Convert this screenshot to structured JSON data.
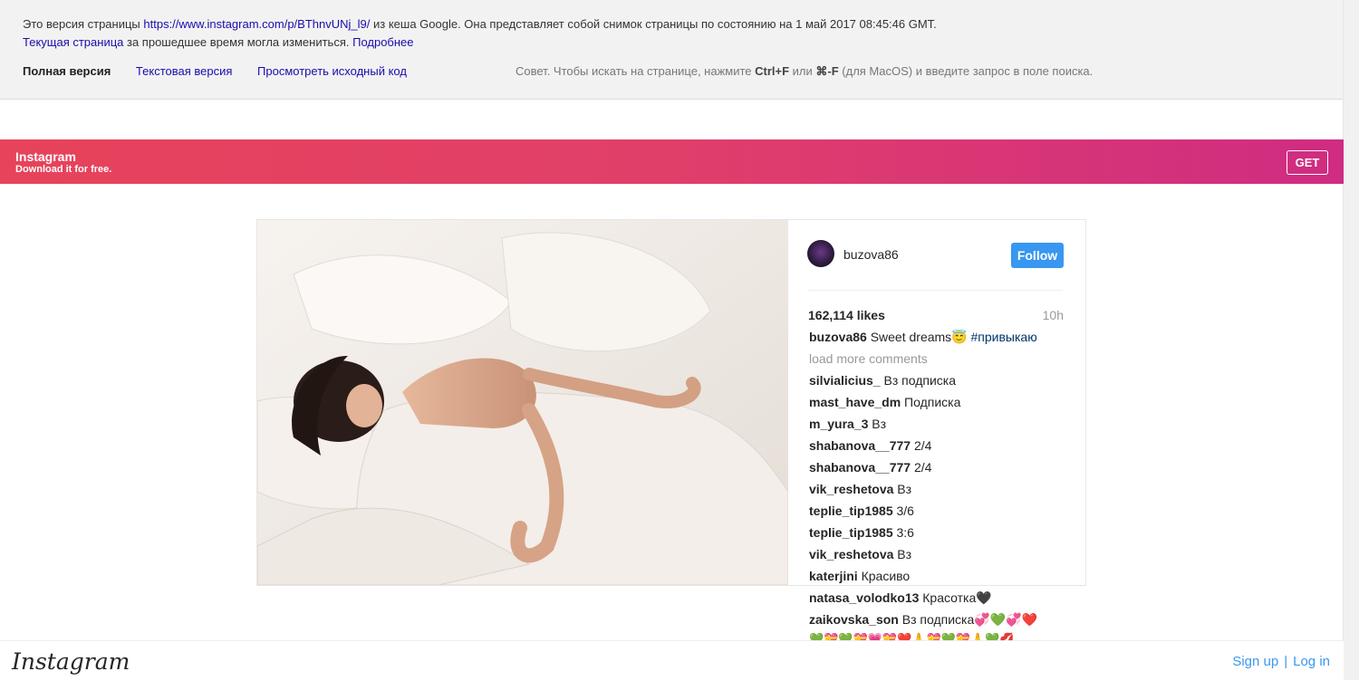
{
  "cache": {
    "line1_prefix": "Это версия страницы ",
    "url": "https://www.instagram.com/p/BThnvUNj_l9/",
    "line1_suffix": " из кеша Google. Она представляет собой снимок страницы по состоянию на 1 май 2017 08:45:46 GMT.",
    "current_page_link": "Текущая страница",
    "line2_middle": " за прошедшее время могла измениться. ",
    "more_link": "Подробнее",
    "nav_full": "Полная версия",
    "nav_text": "Текстовая версия",
    "nav_source": "Просмотреть исходный код",
    "tip_prefix": "Совет. Чтобы искать на странице, нажмите ",
    "tip_key1": "Ctrl+F",
    "tip_or": " или ",
    "tip_key2": "⌘-F",
    "tip_suffix": " (для MacOS) и введите запрос в поле поиска."
  },
  "banner": {
    "title": "Instagram",
    "subtitle": "Download it for free.",
    "get_label": "GET"
  },
  "post": {
    "username": "buzova86",
    "follow_label": "Follow",
    "likes": "162,114 likes",
    "time": "10h",
    "caption_user": "buzova86",
    "caption_text": " Sweet dreams😇 ",
    "caption_hashtag": "#привыкаю",
    "load_more": "load more comments",
    "comments": [
      {
        "user": "silvialicius_",
        "text": " Вз подписка"
      },
      {
        "user": "mast_have_dm",
        "text": " Подписка"
      },
      {
        "user": "m_yura_3",
        "text": " Вз"
      },
      {
        "user": "shabanova__777",
        "text": " 2/4"
      },
      {
        "user": "shabanova__777",
        "text": " 2/4"
      },
      {
        "user": "vik_reshetova",
        "text": " Вз"
      },
      {
        "user": "teplie_tip1985",
        "text": " 3/6"
      },
      {
        "user": "teplie_tip1985",
        "text": " 3:6"
      },
      {
        "user": "vik_reshetova",
        "text": " Вз"
      },
      {
        "user": "katerjini",
        "text": " Красиво"
      },
      {
        "user": "natasa_volodko13",
        "text": " Красотка🖤"
      },
      {
        "user": "zaikovska_son",
        "text": " Вз подписка💞💚💞❤️"
      }
    ],
    "emoji_line": "💚💝💚💝💗💝❤️🙏💝💚💝🙏💚💋"
  },
  "footer": {
    "logo": "Instagram",
    "sign_up": "Sign up",
    "separator": "|",
    "log_in": "Log in"
  }
}
